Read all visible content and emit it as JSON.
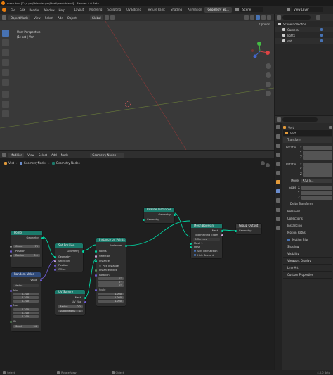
{
  "title_bar": {
    "left": "mesh tool [C:\\d.proj\\blender.proj\\test\\mesh.blend] - Blender 4.0 Beta"
  },
  "menu": [
    "File",
    "Edit",
    "Render",
    "Window",
    "Help"
  ],
  "workspaces": [
    "Layout",
    "Modeling",
    "Sculpting",
    "UV Editing",
    "Texture Paint",
    "Shading",
    "Animation",
    "Geometry No..."
  ],
  "workspace_active": "Geometry No...",
  "scene_label": "Scene",
  "viewlayer_label": "View Layer",
  "viewport": {
    "mode": "Object Mode",
    "view_menu": "View",
    "select_menu": "Select",
    "add_menu": "Add",
    "object_menu": "Object",
    "transform_orientation": "Global",
    "info_line1": "User Perspective",
    "info_line2": "(1) set | Vert",
    "options": "Options"
  },
  "outliner": {
    "root": "Scene Collection",
    "items": [
      "Camera",
      "lights",
      "set"
    ]
  },
  "properties": {
    "object_name": "Vert",
    "data_name": "Vert",
    "sections": {
      "transform": "Transform",
      "location": "Locatio...",
      "rotation": "Rotatio...",
      "mode": "Mode",
      "mode_value": "XYZ E...",
      "scale": "Scale",
      "delta": "Delta Transform",
      "relations": "Relations",
      "collections": "Collections",
      "instancing": "Instancing",
      "motion_paths": "Motion Paths",
      "motion_blur": "Motion Blur",
      "shading": "Shading",
      "visibility": "Visibility",
      "viewport_display": "Viewport Display",
      "line_art": "Line Art",
      "custom_props": "Custom Properties"
    },
    "axis": [
      "X",
      "Y",
      "Z"
    ]
  },
  "node_editor": {
    "editor": "Modifier",
    "view_menu": "View",
    "select_menu": "Select",
    "add_menu": "Add",
    "node_menu": "Node",
    "tree_name": "Geometry Nodes",
    "breadcrumb": [
      "Vert",
      "GeometryNodes",
      "Geometry Nodes"
    ]
  },
  "nodes": {
    "points": {
      "title": "Points",
      "out": "Geometry",
      "count": "Count",
      "count_val": "70",
      "radius": "Radius",
      "radius_val": "0.1"
    },
    "random": {
      "title": "Random Value",
      "out": "Value",
      "type": "Vector",
      "min": "Min",
      "max": "Max",
      "min_vals": [
        "0.200",
        "0.200",
        "0.200"
      ],
      "max_vals": [
        "0.200",
        "0.200",
        "0.200"
      ],
      "id": "ID",
      "seed": "Seed",
      "seed_val": "94"
    },
    "setpos": {
      "title": "Set Position",
      "in": "Geometry",
      "out": "Geometry",
      "sel": "Selection",
      "pos": "Position",
      "off": "Offset"
    },
    "uvsphere": {
      "title": "UV Sphere",
      "out": "Mesh",
      "uv": "UV Map",
      "radius": "Radius",
      "radius_val": "0.2",
      "subdiv": "Subdivisions",
      "subdiv_val": "1"
    },
    "instance": {
      "title": "Instance on Points",
      "out": "Instances",
      "points": "Points",
      "sel": "Selection",
      "inst": "Instance",
      "pick": "Pick Instance",
      "idx": "Instance Index",
      "rot": "Rotation",
      "scale": "Scale",
      "rot_vals": [
        "0°",
        "0°",
        "0°"
      ],
      "scale_vals": [
        "1.000",
        "1.000",
        "1.000"
      ]
    },
    "realize": {
      "title": "Realize Instances",
      "in": "Geometry",
      "out": "Geometry"
    },
    "meshbool": {
      "title": "Mesh Boolean",
      "out": "Mesh",
      "mode": "Difference",
      "in_mesh": "Mesh 1",
      "mesh": "Mesh",
      "inter": "Intersecting Edges",
      "self": "Self Intersection",
      "hole": "Hole Tolerant"
    },
    "groupout": {
      "title": "Group Output",
      "in": "Geometry"
    }
  },
  "status_bar": {
    "select": "Select",
    "rotate": "Rotate View",
    "object": "Object",
    "version": "4.0.0 Beta"
  },
  "colors": {
    "geometry_socket": "#00d6a3",
    "geo_header": "#1b7a6b",
    "input_header": "#83314a",
    "utility_header": "#3b5ca0",
    "accent": "#4772b3"
  }
}
